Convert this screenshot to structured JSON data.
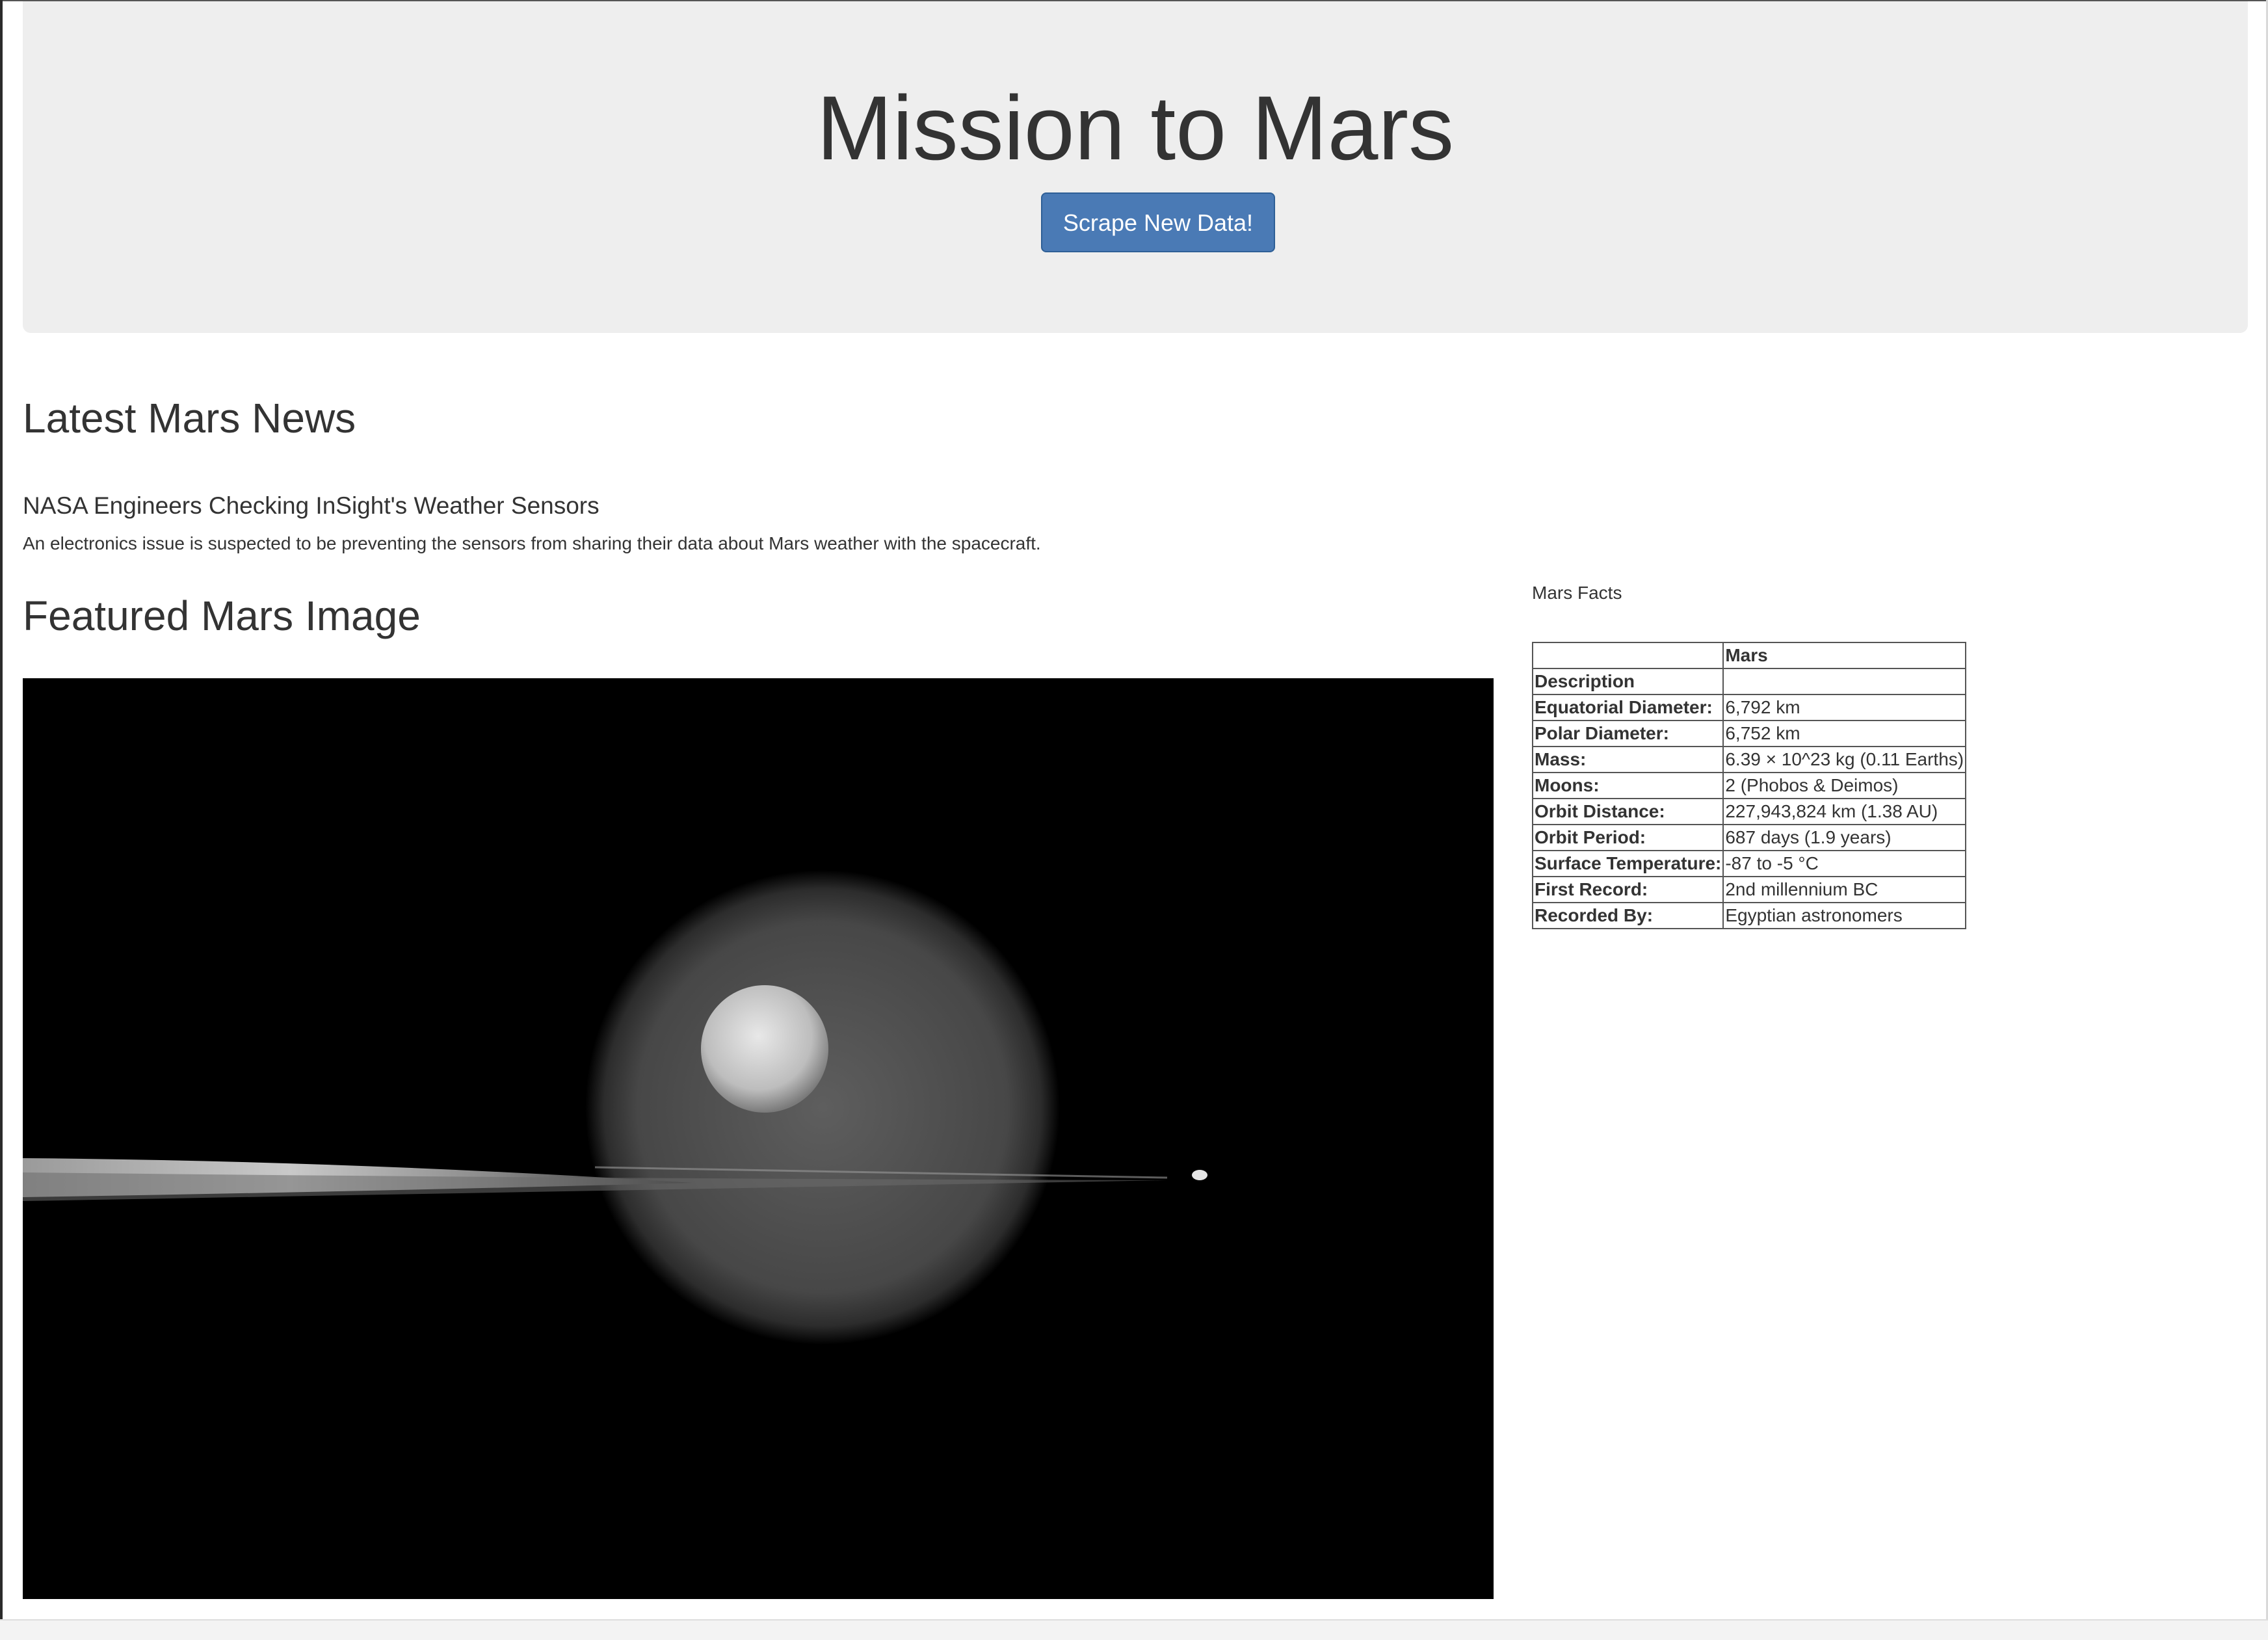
{
  "header": {
    "title": "Mission to Mars",
    "scrape_button_label": "Scrape New Data!",
    "button_color": "#4a7ab5"
  },
  "news": {
    "section_heading": "Latest Mars News",
    "title": "NASA Engineers Checking InSight's Weather Sensors",
    "teaser": "An electronics issue is suspected to be preventing the sensors from sharing their data about Mars weather with the spacecraft."
  },
  "featured": {
    "section_heading": "Featured Mars Image"
  },
  "facts": {
    "caption": "Mars Facts",
    "column_header": "Mars",
    "rows": [
      {
        "label": "Description",
        "value": ""
      },
      {
        "label": "Equatorial Diameter:",
        "value": "6,792 km"
      },
      {
        "label": "Polar Diameter:",
        "value": "6,752 km"
      },
      {
        "label": "Mass:",
        "value": "6.39 × 10^23 kg (0.11 Earths)"
      },
      {
        "label": "Moons:",
        "value": "2 (Phobos & Deimos)"
      },
      {
        "label": "Orbit Distance:",
        "value": "227,943,824 km (1.38 AU)"
      },
      {
        "label": "Orbit Period:",
        "value": "687 days (1.9 years)"
      },
      {
        "label": "Surface Temperature:",
        "value": "-87 to -5 °C"
      },
      {
        "label": "First Record:",
        "value": "2nd millennium BC"
      },
      {
        "label": "Recorded By:",
        "value": "Egyptian astronomers"
      }
    ]
  }
}
